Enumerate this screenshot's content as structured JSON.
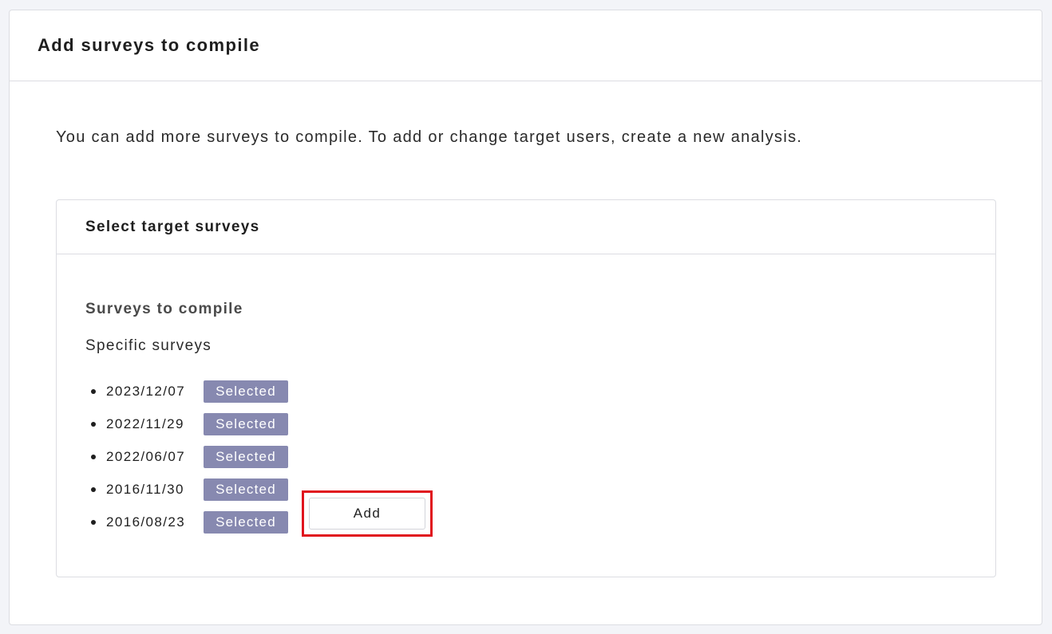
{
  "page": {
    "title": "Add surveys to compile",
    "intro": "You can add more surveys to compile. To add or change target users, create a new analysis."
  },
  "panel": {
    "title": "Select target surveys",
    "section_label": "Surveys to compile",
    "section_sub": "Specific surveys",
    "surveys": [
      {
        "date": "2023/12/07",
        "badge": "Selected"
      },
      {
        "date": "2022/11/29",
        "badge": "Selected"
      },
      {
        "date": "2022/06/07",
        "badge": "Selected"
      },
      {
        "date": "2016/11/30",
        "badge": "Selected"
      },
      {
        "date": "2016/08/23",
        "badge": "Selected"
      }
    ],
    "add_label": "Add"
  },
  "colors": {
    "badge_bg": "#8789b0",
    "highlight": "#e0141e"
  }
}
